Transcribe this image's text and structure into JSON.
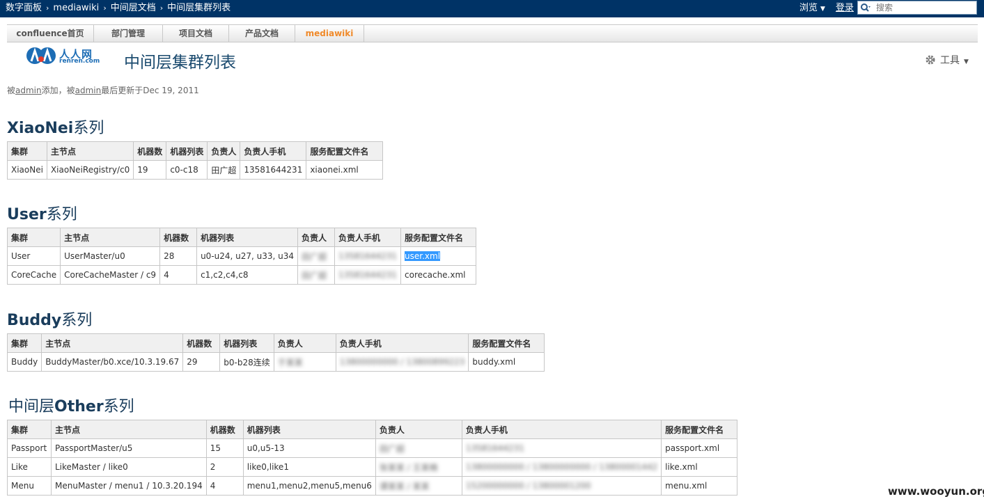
{
  "topbar": {
    "breadcrumbs": [
      "数字面板",
      "mediawiki",
      "中间层文档",
      "中间层集群列表"
    ],
    "browse_label": "浏览",
    "login_label": "登录",
    "search_placeholder": "搜索"
  },
  "nav": {
    "tabs": [
      "confluence首页",
      "部门管理",
      "项目文档",
      "产品文档",
      "mediawiki"
    ],
    "active_tab": "mediawiki"
  },
  "logo": {
    "brand": "人人网",
    "domain": "renren.com"
  },
  "page": {
    "title": "中间层集群列表",
    "tools_label": "工具",
    "meta": {
      "added_prefix": "被",
      "added_user": "admin",
      "added_mid": "添加，被",
      "updated_user": "admin",
      "updated_suffix": "最后更新于Dec 19, 2011"
    }
  },
  "sections": [
    {
      "title_en": "XiaoNei",
      "title_cn": "系列",
      "headers": [
        "集群",
        "主节点",
        "机器数",
        "机器列表",
        "负责人",
        "负责人手机",
        "服务配置文件名"
      ],
      "rows": [
        [
          "XiaoNei",
          "XiaoNeiRegistry/c0",
          "19",
          "c0-c18",
          "田广超",
          "13581644231",
          "xiaonei.xml"
        ]
      ]
    },
    {
      "title_en": "User",
      "title_cn": "系列",
      "headers": [
        "集群",
        "主节点",
        "机器数",
        "机器列表",
        "负责人",
        "负责人手机",
        "服务配置文件名"
      ],
      "rows": [
        [
          "User",
          "UserMaster/u0",
          "28",
          "u0-u24, u27, u33, u34",
          "田广超",
          "13581644231",
          "user.xml"
        ],
        [
          "CoreCache",
          "CoreCacheMaster / c9",
          "4",
          "c1,c2,c4,c8",
          "田广超",
          "13581644231",
          "corecache.xml"
        ]
      ]
    },
    {
      "title_en": "Buddy",
      "title_cn": "系列",
      "headers": [
        "集群",
        "主节点",
        "机器数",
        "机器列表",
        "负责人",
        "负责人手机",
        "服务配置文件名"
      ],
      "rows": [
        [
          "Buddy",
          "BuddyMaster/b0.xce/10.3.19.67",
          "29",
          "b0-b28连续",
          "于某某",
          "13800000000 / 13800899223",
          "buddy.xml"
        ]
      ]
    },
    {
      "title_cn_prefix": "中间层",
      "title_en": "Other",
      "title_cn": "系列",
      "headers": [
        "集群",
        "主节点",
        "机器数",
        "机器列表",
        "负责人",
        "负责人手机",
        "服务配置文件名"
      ],
      "rows": [
        [
          "Passport",
          "PassportMaster/u5",
          "15",
          "u0,u5-13",
          "田广超",
          "13581644231",
          "passport.xml"
        ],
        [
          "Like",
          "LikeMaster / like0",
          "2",
          "like0,like1",
          "张某某 / 王某楠",
          "13800000000 / 13800000000 / 13800001442",
          "like.xml"
        ],
        [
          "Menu",
          "MenuMaster / menu1 / 10.3.20.194",
          "4",
          "menu1,menu2,menu5,menu6",
          "谭某某 / 某某",
          "15200000000 / 13800001200",
          "menu.xml"
        ]
      ]
    }
  ],
  "watermark": "www.wooyun.org",
  "colors": {
    "topbar": "#003366",
    "heading": "#1a3d5c",
    "active_tab": "#f08a2a",
    "selection": "#3399ff"
  }
}
